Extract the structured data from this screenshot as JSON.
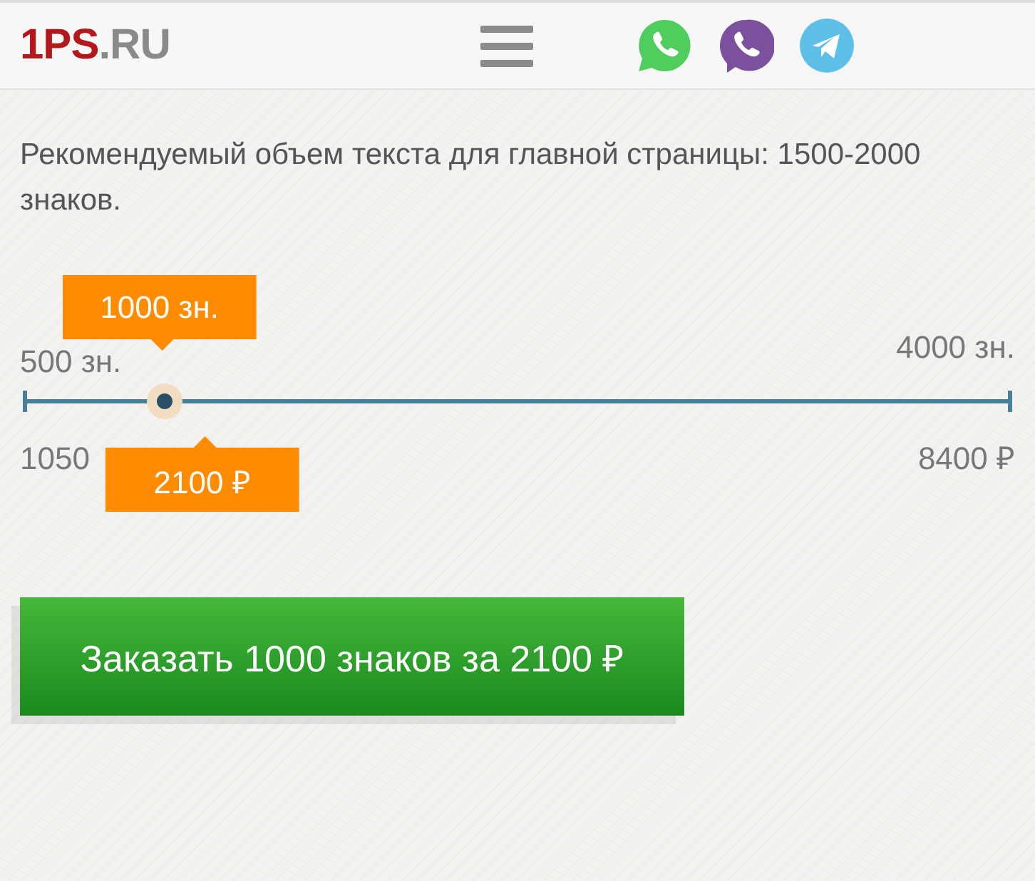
{
  "header": {
    "logo": {
      "brand": "1PS",
      "suffix": ".RU"
    }
  },
  "intro": "Рекомендуемый объем текста для главной страницы: 1500-2000 знаков.",
  "slider": {
    "min_label": "500 зн.",
    "max_label": "4000 зн.",
    "min_price": "1050",
    "max_price": "8400 ₽",
    "value_label": "1000 зн.",
    "price_label": "2100 ₽",
    "level": 0.143
  },
  "order_button": "Заказать 1000 знаков за 2100 ₽"
}
